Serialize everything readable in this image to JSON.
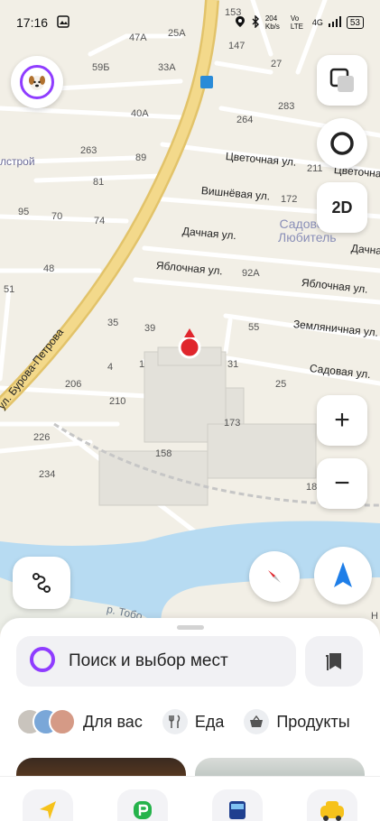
{
  "status_bar": {
    "time": "17:16",
    "network_speed": "204 Kb/s",
    "volte": "Vo LTE",
    "signal": "4G",
    "battery": "53"
  },
  "map": {
    "house_numbers": [
      "153",
      "47A",
      "25A",
      "59Б",
      "33A",
      "147",
      "27",
      "40A",
      "283",
      "264",
      "263",
      "89",
      "81",
      "95",
      "70",
      "74",
      "172",
      "48",
      "92A",
      "51",
      "35",
      "39",
      "55",
      "4",
      "1",
      "31",
      "206",
      "25",
      "210",
      "173",
      "226",
      "158",
      "234",
      "18"
    ],
    "streets": {
      "tsvetochnaya": "Цветочная ул.",
      "tsvetochnaya2": "Цветочна",
      "vishnevaya": "Вишнёвая ул.",
      "dachnaya": "Дачная ул.",
      "dachnaya2": "Дачна",
      "yablochnaya1": "Яблочная ул.",
      "yablochnaya2": "Яблочная ул.",
      "zemlyanichnaya": "Земляничная ул.",
      "sadovaya": "Садовая ул.",
      "burova": "ул. Бурова-Петрова",
      "river": "р. Тобо",
      "elstroy": "лстрой"
    },
    "district": "Садовод-\nЛюбитель",
    "house_211": "211",
    "house_н": "Н"
  },
  "controls": {
    "map_mode_label": "2D",
    "zoom_in": "+",
    "zoom_out": "−"
  },
  "sheet": {
    "search_placeholder": "Поиск и выбор мест",
    "categories": [
      {
        "label": "Для вас",
        "icon": "for-you-icon"
      },
      {
        "label": "Еда",
        "icon": "food-icon"
      },
      {
        "label": "Продукты",
        "icon": "groceries-icon"
      }
    ]
  },
  "colors": {
    "accent_purple": "#8f3cff",
    "road_yellow": "#f1d27a",
    "water": "#b7dbf2",
    "compass_blue": "#1e7ee8",
    "pin_red": "#e0262d"
  }
}
